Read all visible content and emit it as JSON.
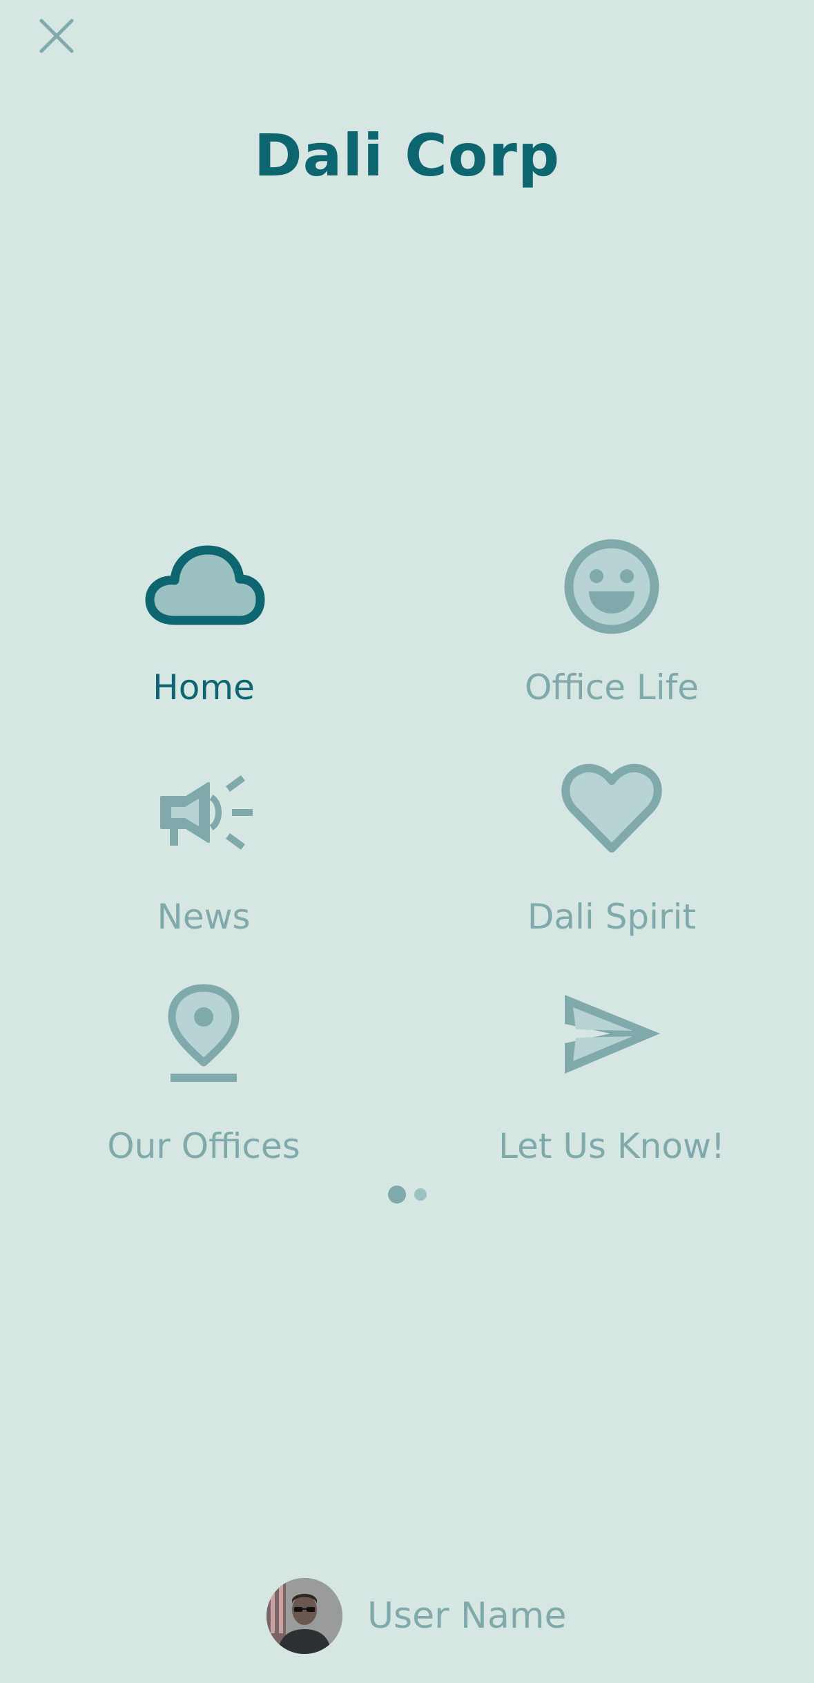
{
  "header": {
    "title": "Dali Corp"
  },
  "menu": {
    "items": [
      {
        "label": "Home",
        "icon": "cloud-icon",
        "active": true
      },
      {
        "label": "Office Life",
        "icon": "smiley-icon",
        "active": false
      },
      {
        "label": "News",
        "icon": "megaphone-icon",
        "active": false
      },
      {
        "label": "Dali Spirit",
        "icon": "heart-icon",
        "active": false
      },
      {
        "label": "Our Offices",
        "icon": "location-pin-icon",
        "active": false
      },
      {
        "label": "Let Us Know!",
        "icon": "send-icon",
        "active": false
      }
    ]
  },
  "pager": {
    "current_page": 1,
    "total_pages": 2
  },
  "user": {
    "name": "User Name"
  },
  "colors": {
    "background": "#d6e6e3",
    "accent": "#0d6570",
    "muted": "#7fa9aa"
  }
}
